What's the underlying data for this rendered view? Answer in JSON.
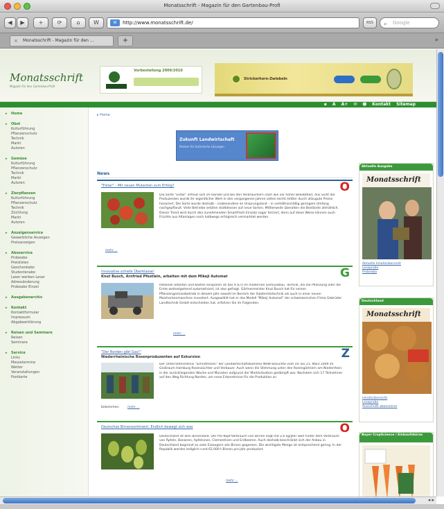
{
  "window": {
    "title": "Monatsschrift - Magazin für den Gartenbau-Profi"
  },
  "toolbar": {
    "back": "◀",
    "forward": "▶",
    "add_bookmark": "+",
    "reload": "⟳",
    "home": "⌂",
    "address_icon": "W",
    "url": "http://www.monatsschrift.de/",
    "rss_badge": "RSS",
    "search_placeholder": "Google"
  },
  "tabs": {
    "active_label": "Monatsschrift - Magazin für den ...",
    "add": "+"
  },
  "site": {
    "logo": "Monatsschrift",
    "tagline": "Magazin für den Gartenbau-Profi",
    "ad1_text": "Vorbestellung 2009/2010",
    "ad1_brand": "Hammer",
    "ad2_text": "Strickerhorn-Zwiebeln",
    "toolbar_tools": "▪ A A+ ✉ 🖶   Kontakt   Sitemap"
  },
  "nav": [
    {
      "head": "Home",
      "items": []
    },
    {
      "head": "Obst",
      "items": [
        "Kulturführung",
        "Pflanzenschutz",
        "Technik",
        "Markt",
        "Autoren"
      ]
    },
    {
      "head": "Gemüse",
      "items": [
        "Kulturführung",
        "Pflanzenschutz",
        "Technik",
        "Markt",
        "Autoren"
      ]
    },
    {
      "head": "Zierpflanzen",
      "items": [
        "Kulturführung",
        "Pflanzenschutz",
        "Technik",
        "Züchtung",
        "Markt",
        "Autoren"
      ]
    },
    {
      "head": "Anzeigenservice",
      "items": [
        "Gewerbliche Anzeigen",
        "Preisanzeigen"
      ]
    },
    {
      "head": "Aboservice",
      "items": [
        "Probeabo",
        "Preislisten",
        "Geschenkabo",
        "Studentenabo",
        "Leser werben Leser",
        "Adressänderung",
        "Probeabo Einzel"
      ]
    },
    {
      "head": "Ausgabenarchiv",
      "items": []
    },
    {
      "head": "Kontakt",
      "items": [
        "Kontaktformular",
        "Impressum",
        "Abgabeerklärung"
      ]
    },
    {
      "head": "Reisen und Seminare",
      "items": [
        "Reisen",
        "Seminare"
      ]
    },
    {
      "head": "Service",
      "items": [
        "Links",
        "Messetermine",
        "Wetter",
        "Veranstaltungen",
        "Postkarte"
      ]
    }
  ],
  "main": {
    "breadcrumb": "Home",
    "banner_title": "Zukunft Landwirtschaft",
    "banner_sub": "Partner für technische Lösungen",
    "news_heading": "News",
    "articles": [
      {
        "title": "\"Elstar\" - Mit neuen Mutanten zum Erfolg?",
        "subtitle": "",
        "letter": "O",
        "color": "#d42424",
        "text": "Die Sorte \"Elstar\" erfreut sich im Handel und bei den Verbrauchern nach wie vor hoher Beliebtheit. Aus Sicht der Produzenten wurde ihr eigentlicher Wert in den vergangenen Jahren selten leicht mittler durch allzugute Preise honoriert. Die Sorte wurde deshalb – insbesondere im Ursprungsland – in verhältnismäßig geringem Umfang nachgepflanzt. Viele Betriebe setzten stattdessen auf neue Sorten. Mittlerweile überalten die Bestände allmählich. Dieser Trend wird durch den zunehmenden Smartfresh-Einsatz sogar forciert, denn auf diese Weise können auch Früchte aus Altanlagen noch halbwegs erfolgreich vermarktet werden.",
        "more": "mehr ..."
      },
      {
        "title": "Innovative schiefe Überklasse!",
        "subtitle": "Knut Busch, Arnfried Pfestlein, arbeiten mit dem Mikeji Automat",
        "letter": "G",
        "color": "#3a9a3a",
        "text": "Rationell arbeiten und Kosten einsparen ist das A & O im modernen Gemüsebau. Technik, die die Pflanzung oder die Ernte weitestgehend automatisiert, ist also gefragt. Gärtnermeister Knut Busch hat für seinen Pflanzengemüsebetrieb in diesem Jahr sowohl im Bereich der Salaterntetechnik als auch in einer neuen Maisheckenmaschine investiert. Ausgewählt hat er das Modell \"Mikeji Automat\" der schweizerischen Firma Gebrüder Landtechnik GmbH entschieden hat, erfahren Sie im Folgenden.",
        "more": "mehr ..."
      },
      {
        "title": "\"Der Norden gibt Gas!\"",
        "subtitle": "Niederrheinische Rosenproduzenten auf Exkursion",
        "letter": "Z",
        "color": "#2d5f95",
        "text": "Der Unternehmerkreis \"Schnittrosen\" der Landwirtschaftskammer NRW besuchte vom 19. bis 21. März 2009 im Großraum Hamburg Rosenzüchter und Verbauer. Auch wenn die Stimmung unter den Rosengärtnern am Niederrhein in der zurückliegenden Woche und Monaten aufgrund der Marktsituation gedämpft war. Nachdem sich 17 Teilnehmer auf den Weg Richtung Norden, um neue Erkenntnisse für die Produktion zu",
        "prefix": "bekommen.",
        "more": "mehr ..."
      },
      {
        "title": "Deutsches Birnensortiment: Endlich bewegt sich was",
        "subtitle": "",
        "letter": "O",
        "color": "#d42424",
        "text": "Deutschland ist kein Birnenland. Der Pro-Kopf-Verbrauch von Birnen liegt mit 2,6 kg/Jahr weit hinter dem Verbrauch von Äpfeln, Bananen, Apfelsinen, Clementinen und Erdbeeren. Auch deshalb beschränkt sich der Anbau in Deutschland begrenzt so viele Erzeugern wie Birnen gegessen. Die wichtigste Menge ist entsprechend gering. In der Republik werden lediglich rund 62.000 t Birnen pro Jahr produziert.",
        "more": "mehr ..."
      }
    ]
  },
  "sidebar": [
    {
      "head": "Aktuelle Ausgabe",
      "cover": "Monatsschrift",
      "links": [
        "Aktuelle Inhaltsübersicht",
        "Leseprobe",
        "Probeabo"
      ]
    },
    {
      "head": "Deutschland",
      "cover": "Monatsschrift",
      "links": [
        "Inhaltsübersicht",
        "Leseprobe",
        "Ausschnitt abonnieren"
      ]
    },
    {
      "head": "Bayer CropScience / Einkaufsbörse",
      "cover": "",
      "links": []
    }
  ]
}
